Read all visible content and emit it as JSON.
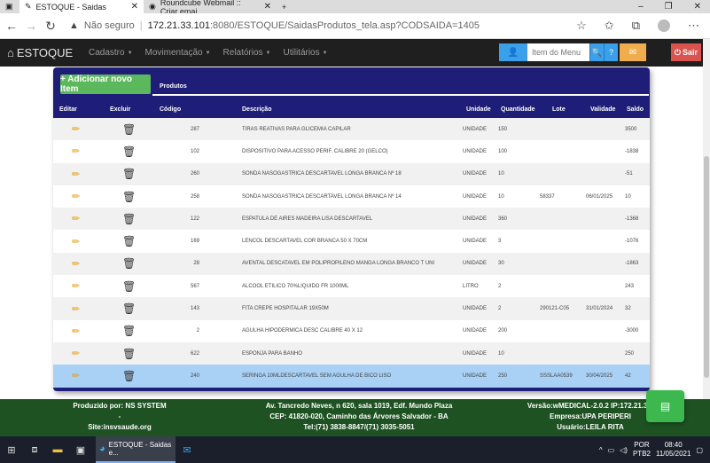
{
  "browser": {
    "tabs": [
      {
        "title": "ESTOQUE - Saidas",
        "active": true
      },
      {
        "title": "Roundcube Webmail :: Criar emai",
        "active": false
      }
    ],
    "new_tab": "+",
    "window_controls": {
      "minimize": "–",
      "restore": "❐",
      "close": "✕"
    },
    "security_label": "Não seguro",
    "url_host": "172.21.33.101",
    "url_path": ":8080/ESTOQUE/SaidasProdutos_tela.asp?CODSAIDA=1405"
  },
  "app": {
    "brand": "ESTOQUE",
    "menus": [
      "Cadastro",
      "Movimentação",
      "Relatórios",
      "Utilitários"
    ],
    "menu_search_placeholder": "Item do Menu",
    "logout_label": "Sair"
  },
  "form": {
    "add_button": "+ Adicionar novo Item",
    "products_label": "Produtos"
  },
  "table": {
    "headers": {
      "edit": "Editar",
      "delete": "Excluir",
      "code": "Código",
      "description": "Descrição",
      "unit": "Unidade",
      "quantity": "Quantidade",
      "lot": "Lote",
      "validity": "Validade",
      "balance": "Saldo"
    },
    "rows": [
      {
        "code": "287",
        "description": "TIRAS REATIVAS PARA GLICEMIA CAPILAR",
        "unit": "UNIDADE",
        "quantity": "150",
        "lot": "",
        "validity": "",
        "balance": "3500"
      },
      {
        "code": "102",
        "description": "DISPOSITIVO PARA ACESSO PERIF. CALIBRE 20 (GELCO)",
        "unit": "UNIDADE",
        "quantity": "100",
        "lot": "",
        "validity": "",
        "balance": "-1838"
      },
      {
        "code": "260",
        "description": "SONDA NASOGASTRICA DESCARTAVEL LONGA BRANCA Nº 18",
        "unit": "UNIDADE",
        "quantity": "10",
        "lot": "",
        "validity": "",
        "balance": "-51"
      },
      {
        "code": "258",
        "description": "SONDA NASOGASTRICA DESCARTAVEL LONGA BRANCA Nº 14",
        "unit": "UNIDADE",
        "quantity": "10",
        "lot": "58337",
        "validity": "06/01/2025",
        "balance": "10"
      },
      {
        "code": "122",
        "description": "ESPATULA DE AIRES MADEIRA LISA DESCARTAVEL",
        "unit": "UNIDADE",
        "quantity": "360",
        "lot": "",
        "validity": "",
        "balance": "-1368"
      },
      {
        "code": "169",
        "description": "LENCOL DESCARTAVEL COR BRANCA 50 X 70CM",
        "unit": "UNIDADE",
        "quantity": "3",
        "lot": "",
        "validity": "",
        "balance": "-1076"
      },
      {
        "code": "28",
        "description": "AVENTAL DESCATAVEL EM POLIPROPILENO MANGA LONGA BRANCO T UNI",
        "unit": "UNIDADE",
        "quantity": "30",
        "lot": "",
        "validity": "",
        "balance": "-1863"
      },
      {
        "code": "567",
        "description": "ALCOOL ETILICO 70%LIQUIDO FR 1000ML",
        "unit": "LITRO",
        "quantity": "2",
        "lot": "",
        "validity": "",
        "balance": "243"
      },
      {
        "code": "143",
        "description": "FITA CREPE HOSPITALAR 19X50M",
        "unit": "UNIDADE",
        "quantity": "2",
        "lot": "290121-C05",
        "validity": "31/01/2024",
        "balance": "32"
      },
      {
        "code": "2",
        "description": "AGULHA HIPODERMICA DESC CALIBRE 40 X 12",
        "unit": "UNIDADE",
        "quantity": "200",
        "lot": "",
        "validity": "",
        "balance": "-3000"
      },
      {
        "code": "622",
        "description": "ESPONJA PARA BANHO",
        "unit": "UNIDADE",
        "quantity": "10",
        "lot": "",
        "validity": "",
        "balance": "250"
      },
      {
        "code": "240",
        "description": "SERINGA 10MLDESCARTAVEL SEM AGULHA DE BICO LISO",
        "unit": "UNIDADE",
        "quantity": "250",
        "lot": "SSSLAA0539",
        "validity": "30/04/2025",
        "balance": "42",
        "selected": true
      }
    ]
  },
  "footer": {
    "left": [
      "Produzido por: NS SYSTEM",
      "-",
      "Site:insvsaude.org"
    ],
    "center": [
      "Av. Tancredo Neves, n 620, sala 1019, Edf. Mundo Plaza",
      "CEP: 41820-020, Caminho das Árvores Salvador - BA",
      "Tel:(71) 3838-8847/(71) 3035-5051"
    ],
    "right": [
      "Versão:wMEDICAL-2.0.2 IP:172.21.33.",
      "Empresa:UPA PERIPERI",
      "Usuário:LEILA RITA"
    ]
  },
  "taskbar": {
    "task_label": "ESTOQUE - Saidas e...",
    "lang_top": "POR",
    "lang_bottom": "PTB2",
    "time": "08:40",
    "date": "11/05/2021"
  },
  "colors": {
    "navbar": "#1f1f1f",
    "table_header": "#1e1e78",
    "add_button": "#5cb85c",
    "footer": "#1e5222",
    "logout": "#d9534f",
    "selected_row": "#a9d1f5"
  }
}
